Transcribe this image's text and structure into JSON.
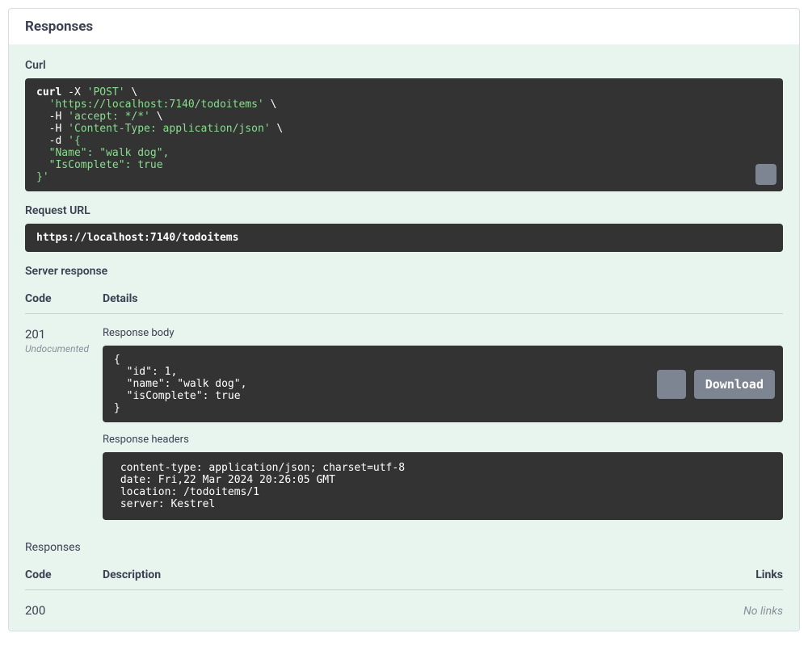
{
  "header": {
    "title": "Responses"
  },
  "curl": {
    "label": "Curl",
    "tokens": {
      "l1_cmd": "curl",
      "l1_rest": " -X ",
      "l1_method": "'POST'",
      "l1_end": " \\",
      "l2_indent": "  ",
      "l2_url": "'https://localhost:7140/todoitems'",
      "l2_end": " \\",
      "l3_indent": "  -H ",
      "l3_hdr": "'accept: */*'",
      "l3_end": " \\",
      "l4_indent": "  -H ",
      "l4_hdr": "'Content-Type: application/json'",
      "l4_end": " \\",
      "l5_indent": "  -d ",
      "l5_start": "'{",
      "l6_indent": "  ",
      "l6_body": "\"Name\": \"walk dog\",",
      "l7_indent": "  ",
      "l7_body": "\"IsComplete\": true",
      "l8": "}'"
    }
  },
  "request_url": {
    "label": "Request URL",
    "value": "https://localhost:7140/todoitems"
  },
  "server_response": {
    "label": "Server response",
    "columns": {
      "code": "Code",
      "details": "Details"
    },
    "entry": {
      "code": "201",
      "note": "Undocumented",
      "body_label": "Response body",
      "body": {
        "open": "{",
        "l_id_key": "  \"id\"",
        "l_id_sep": ": ",
        "l_id_val": "1",
        "l_id_end": ",",
        "l_name_key": "  \"name\"",
        "l_name_sep": ": ",
        "l_name_val": "\"walk dog\"",
        "l_name_end": ",",
        "l_ic_key": "  \"isComplete\"",
        "l_ic_sep": ": ",
        "l_ic_val": "true",
        "close": "}"
      },
      "download_label": "Download",
      "headers_label": "Response headers",
      "headers_text": " content-type: application/json; charset=utf-8 \n date: Fri,22 Mar 2024 20:26:05 GMT \n location: /todoitems/1 \n server: Kestrel "
    }
  },
  "responses_section": {
    "label": "Responses",
    "columns": {
      "code": "Code",
      "description": "Description",
      "links": "Links"
    },
    "row": {
      "code": "200",
      "links": "No links"
    }
  }
}
